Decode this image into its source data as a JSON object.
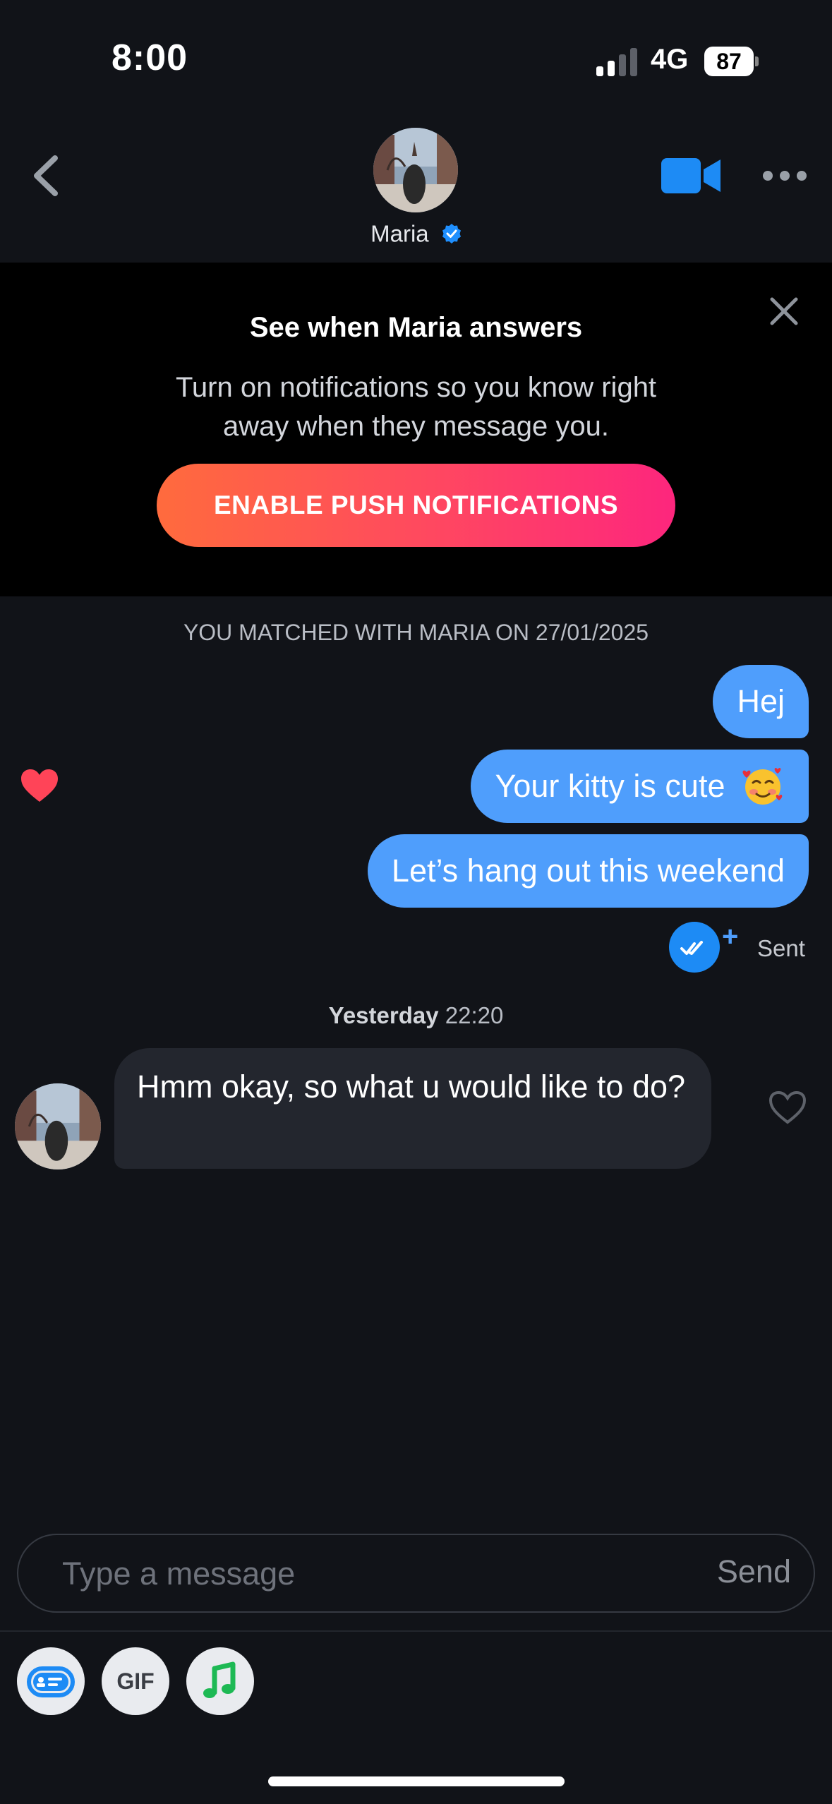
{
  "status_bar": {
    "time": "8:00",
    "network": "4G",
    "battery": "87"
  },
  "header": {
    "name": "Maria",
    "avatar": "profile-photo",
    "verified_icon": "verified-check-icon",
    "back_icon": "chevron-left-icon",
    "video_icon": "video-camera-icon",
    "more_icon": "more-dots-icon"
  },
  "banner": {
    "title": "See when Maria answers",
    "body": "Turn on notifications so you know right away when they message you.",
    "button": "ENABLE PUSH NOTIFICATIONS",
    "close_icon": "close-icon"
  },
  "chat": {
    "match_text": "YOU MATCHED WITH MARIA ON 27/01/2025",
    "outgoing": [
      {
        "text": "Hej"
      },
      {
        "text": "Your kitty is cute",
        "emoji": "smiling-face-with-hearts"
      },
      {
        "text": "Let’s hang out this weekend"
      }
    ],
    "sent_status": "Sent",
    "timestamp_day": "Yesterday",
    "timestamp_time": "22:20",
    "incoming": [
      {
        "text": "Hmm okay, so what u would like to do?"
      }
    ]
  },
  "composer": {
    "placeholder": "Type a message",
    "send_label": "Send",
    "tools": [
      {
        "name": "sticker-card-icon"
      },
      {
        "name": "gif",
        "label": "GIF"
      },
      {
        "name": "music-note-icon"
      }
    ]
  },
  "colors": {
    "accent_blue": "#4f9efc",
    "gradient_start": "#ff6b3d",
    "gradient_end": "#fd267d",
    "background": "#111318"
  }
}
